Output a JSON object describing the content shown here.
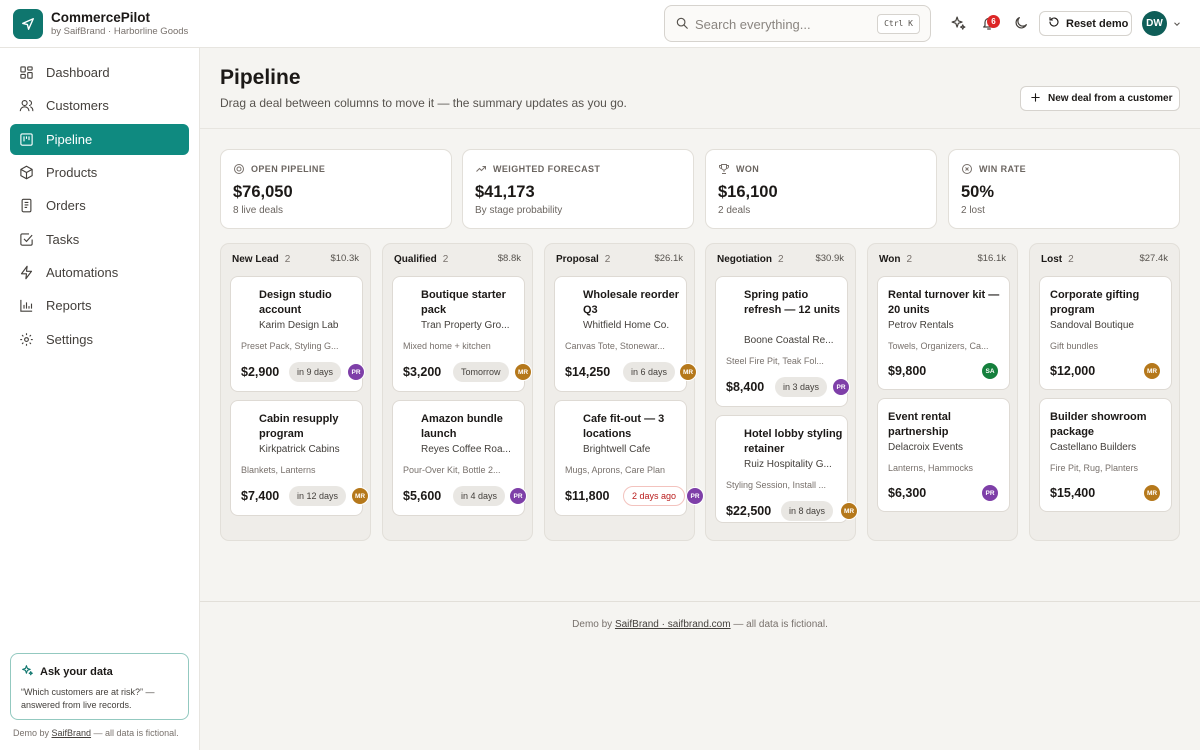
{
  "app": {
    "name": "CommercePilot",
    "subtitle": "by SaifBrand · Harborline Goods"
  },
  "topbar": {
    "search_placeholder": "Search everything...",
    "search_shortcut": "Ctrl K",
    "notification_count": "6",
    "reset_label": "Reset demo",
    "user_initials": "DW"
  },
  "sidebar": {
    "items": [
      {
        "label": "Dashboard",
        "icon": "grid-icon"
      },
      {
        "label": "Customers",
        "icon": "users-icon"
      },
      {
        "label": "Pipeline",
        "icon": "kanban-icon",
        "active": true
      },
      {
        "label": "Products",
        "icon": "box-icon"
      },
      {
        "label": "Orders",
        "icon": "document-icon"
      },
      {
        "label": "Tasks",
        "icon": "check-square-icon"
      },
      {
        "label": "Automations",
        "icon": "bolt-icon"
      },
      {
        "label": "Reports",
        "icon": "bar-chart-icon"
      },
      {
        "label": "Settings",
        "icon": "gear-icon"
      }
    ],
    "ask": {
      "title": "Ask your data",
      "desc": "“Which customers are at risk?” — answered from live records."
    },
    "footer": {
      "prefix": "Demo by ",
      "link": "SaifBrand",
      "suffix": " — all data is fictional."
    }
  },
  "page": {
    "title": "Pipeline",
    "subtitle": "Drag a deal between columns to move it — the summary updates as you go.",
    "new_deal_label": "New deal from a customer"
  },
  "kpis": [
    {
      "label": "OPEN PIPELINE",
      "value": "$76,050",
      "sub": "8 live deals",
      "icon": "target-icon"
    },
    {
      "label": "WEIGHTED FORECAST",
      "value": "$41,173",
      "sub": "By stage probability",
      "icon": "trend-up-icon"
    },
    {
      "label": "WON",
      "value": "$16,100",
      "sub": "2 deals",
      "icon": "trophy-icon"
    },
    {
      "label": "WIN RATE",
      "value": "50%",
      "sub": "2 lost",
      "icon": "x-circle-icon"
    }
  ],
  "columns": [
    {
      "name": "New Lead",
      "count": "2",
      "total": "$10.3k",
      "cards": [
        {
          "title": "Design studio account",
          "customer": "Karim Design Lab",
          "items": "Preset Pack, Styling G...",
          "amount": "$2,900",
          "due": "in 9 days",
          "owner": "PR",
          "owner_color": "#7e3fa8"
        },
        {
          "title": "Cabin resupply program",
          "customer": "Kirkpatrick Cabins",
          "items": "Blankets, Lanterns",
          "amount": "$7,400",
          "due": "in 12 days",
          "owner": "MR",
          "owner_color": "#b5781b"
        }
      ]
    },
    {
      "name": "Qualified",
      "count": "2",
      "total": "$8.8k",
      "cards": [
        {
          "title": "Boutique starter pack",
          "customer": "Tran Property Gro...",
          "items": "Mixed home + kitchen",
          "amount": "$3,200",
          "due": "Tomorrow",
          "owner": "MR",
          "owner_color": "#b5781b"
        },
        {
          "title": "Amazon bundle launch",
          "customer": "Reyes Coffee Roa...",
          "items": "Pour-Over Kit, Bottle 2...",
          "amount": "$5,600",
          "due": "in 4 days",
          "owner": "PR",
          "owner_color": "#7e3fa8"
        }
      ]
    },
    {
      "name": "Proposal",
      "count": "2",
      "total": "$26.1k",
      "cards": [
        {
          "title": "Wholesale reorder Q3",
          "customer": "Whitfield Home Co.",
          "items": "Canvas Tote, Stonewar...",
          "amount": "$14,250",
          "due": "in 6 days",
          "owner": "MR",
          "owner_color": "#b5781b"
        },
        {
          "title": "Cafe fit-out — 3 locations",
          "customer": "Brightwell Cafe",
          "items": "Mugs, Aprons, Care Plan",
          "amount": "$11,800",
          "due": "2 days ago",
          "overdue": true,
          "owner": "PR",
          "owner_color": "#7e3fa8"
        }
      ]
    },
    {
      "name": "Negotiation",
      "count": "2",
      "total": "$30.9k",
      "cards": [
        {
          "title": "Spring patio refresh — 12 units",
          "customer": "Boone Coastal Re...",
          "items": "Steel Fire Pit, Teak Fol...",
          "amount": "$8,400",
          "due": "in 3 days",
          "owner": "PR",
          "owner_color": "#7e3fa8"
        },
        {
          "title": "Hotel lobby styling retainer",
          "customer": "Ruiz Hospitality G...",
          "items": "Styling Session, Install ...",
          "amount": "$22,500",
          "due": "in 8 days",
          "owner": "MR",
          "owner_color": "#b5781b"
        }
      ]
    },
    {
      "name": "Won",
      "count": "2",
      "total": "$16.1k",
      "cards": [
        {
          "title": "Rental turnover kit — 20 units",
          "customer": "Petrov Rentals",
          "items": "Towels, Organizers, Ca...",
          "amount": "$9,800",
          "owner": "SA",
          "owner_color": "#15803d"
        },
        {
          "title": "Event rental partnership",
          "customer": "Delacroix Events",
          "items": "Lanterns, Hammocks",
          "amount": "$6,300",
          "owner": "PR",
          "owner_color": "#7e3fa8"
        }
      ]
    },
    {
      "name": "Lost",
      "count": "2",
      "total": "$27.4k",
      "cards": [
        {
          "title": "Corporate gifting program",
          "customer": "Sandoval Boutique",
          "items": "Gift bundles",
          "amount": "$12,000",
          "owner": "MR",
          "owner_color": "#b5781b"
        },
        {
          "title": "Builder showroom package",
          "customer": "Castellano Builders",
          "items": "Fire Pit, Rug, Planters",
          "amount": "$15,400",
          "owner": "MR",
          "owner_color": "#b5781b"
        }
      ]
    }
  ],
  "footer": {
    "prefix": "Demo by ",
    "link": "SaifBrand · saifbrand.com",
    "suffix": " — all data is fictional."
  },
  "colors": {
    "accent": "#0f8a80",
    "brand": "#0f766e",
    "danger": "#dc2626"
  }
}
